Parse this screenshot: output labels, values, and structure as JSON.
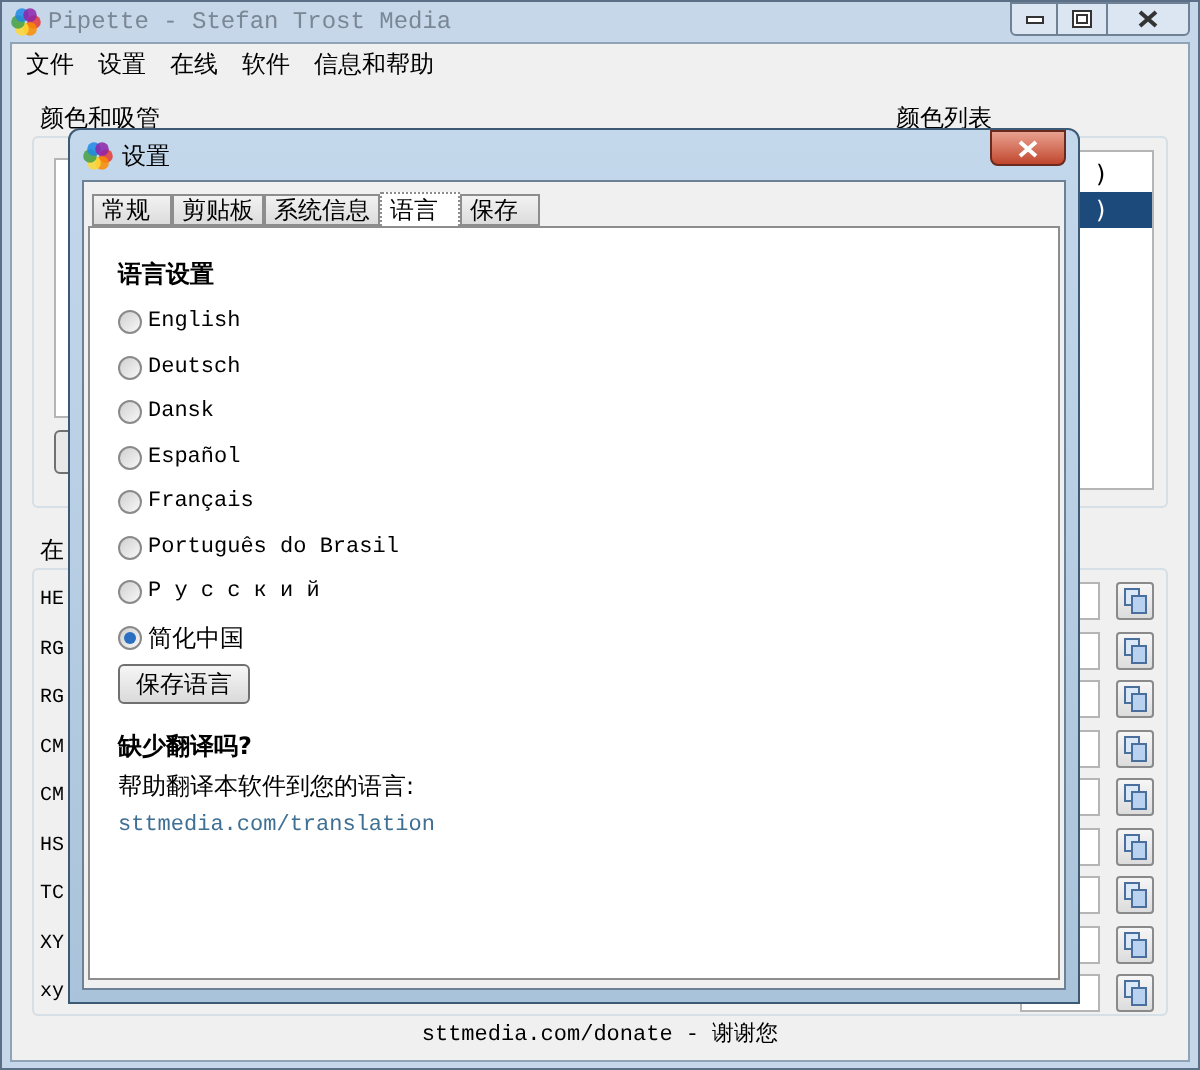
{
  "window": {
    "title": "Pipette - Stefan Trost Media"
  },
  "menu": [
    "文件",
    "设置",
    "在线",
    "软件",
    "信息和帮助"
  ],
  "groups": {
    "left": "颜色和吸管",
    "right": "颜色列表",
    "lower": "在"
  },
  "color_list": [
    {
      "text": ")",
      "selected": false
    },
    {
      "text": ")",
      "selected": true
    }
  ],
  "rows": [
    "HE",
    "RG",
    "RG",
    "CM",
    "CM",
    "HS",
    "TC",
    "XY",
    "xy"
  ],
  "status": "sttmedia.com/donate - 谢谢您",
  "dialog": {
    "title": "设置",
    "tabs": [
      {
        "label": "常规",
        "selected": false
      },
      {
        "label": "剪贴板",
        "selected": false
      },
      {
        "label": "系统信息",
        "selected": false
      },
      {
        "label": "语言",
        "selected": true
      },
      {
        "label": "保存",
        "selected": false
      }
    ],
    "heading": "语言设置",
    "languages": [
      {
        "label": "English",
        "selected": false
      },
      {
        "label": "Deutsch",
        "selected": false
      },
      {
        "label": "Dansk",
        "selected": false
      },
      {
        "label": "Español",
        "selected": false
      },
      {
        "label": "Français",
        "selected": false
      },
      {
        "label": "Português do Brasil",
        "selected": false
      },
      {
        "label": "Р у с с к и й",
        "selected": false
      },
      {
        "label": "简化中国",
        "selected": true
      }
    ],
    "save_button": "保存语言",
    "missing_heading": "缺少翻译吗?",
    "help_text": "帮助翻译本软件到您的语言:",
    "link": "sttmedia.com/translation"
  }
}
